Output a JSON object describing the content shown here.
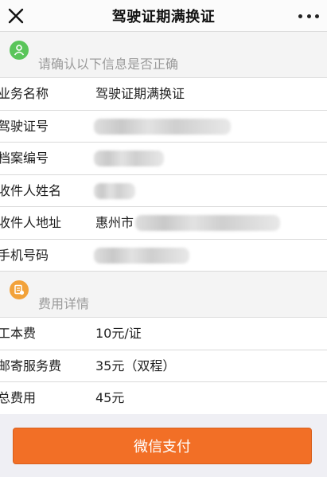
{
  "header": {
    "title": "驾驶证期满换证"
  },
  "confirm": {
    "heading": "请确认以下信息是否正确",
    "rows": [
      {
        "label": "业务名称",
        "value": "驾驶证期满换证"
      },
      {
        "label": "驾驶证号",
        "value": ""
      },
      {
        "label": "档案编号",
        "value": ""
      },
      {
        "label": "收件人姓名",
        "value": ""
      },
      {
        "label": "收件人地址",
        "value": "惠州市"
      },
      {
        "label": "手机号码",
        "value": ""
      }
    ]
  },
  "fees": {
    "heading": "费用详情",
    "rows": [
      {
        "label": "工本费",
        "value": "10元/证"
      },
      {
        "label": "邮寄服务费",
        "value": "35元（双程）"
      },
      {
        "label": "总费用",
        "value": "45元"
      }
    ]
  },
  "footer": {
    "pay_label": "微信支付"
  },
  "colors": {
    "confirm_badge": "#5ac55a",
    "fees_badge": "#f2a23a",
    "pay_button": "#f26f26"
  }
}
